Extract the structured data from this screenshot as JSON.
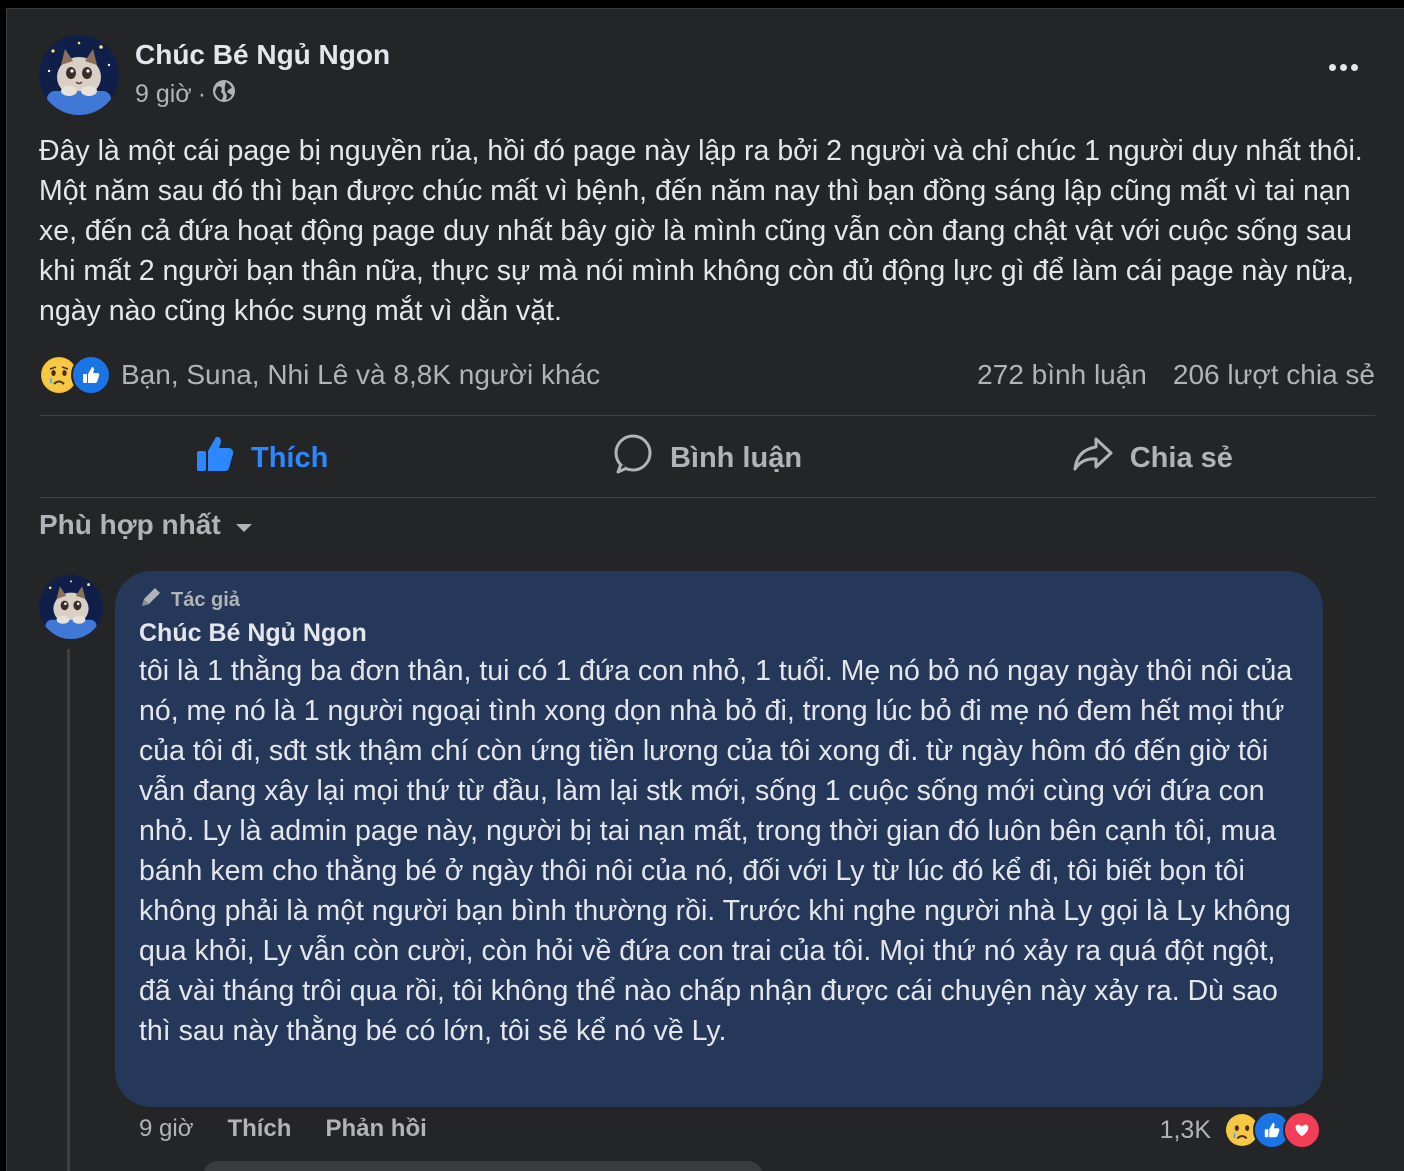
{
  "post": {
    "page_name": "Chúc Bé Ngủ Ngon",
    "time": "9 giờ",
    "separator": "·",
    "text": "Đây là một cái page bị nguyền rủa, hồi đó page này lập ra bởi 2 người và chỉ chúc 1 người duy nhất thôi. Một năm sau đó thì bạn được chúc mất vì bệnh, đến năm nay thì bạn đồng sáng lập cũng mất vì tai nạn xe, đến cả đứa hoạt động page duy nhất bây giờ là mình cũng vẫn còn đang chật vật với cuộc sống sau khi mất 2 người bạn thân nữa, thực sự mà nói mình không còn đủ động lực gì để làm cái page này nữa, ngày nào cũng khóc sưng mắt vì dằn vặt.",
    "reactors": "Bạn, Suna, Nhi Lê và 8,8K người khác",
    "comments_count": "272 bình luận",
    "shares_count": "206 lượt chia sẻ",
    "icons": {
      "privacy": "globe-icon",
      "more": "more-options-icon"
    }
  },
  "actions": {
    "like": "Thích",
    "comment": "Bình luận",
    "share": "Chia sẻ"
  },
  "sort": {
    "label": "Phù hợp nhất"
  },
  "comment": {
    "badge": "Tác giả",
    "author": "Chúc Bé Ngủ Ngon",
    "text": "tôi là 1 thằng ba đơn thân, tui có 1 đứa con nhỏ, 1 tuổi. Mẹ nó bỏ nó ngay ngày thôi nôi của nó, mẹ nó là 1 người ngoại tình xong dọn nhà bỏ đi, trong lúc bỏ đi mẹ nó đem hết mọi thứ của tôi đi, sđt stk thậm chí còn ứng tiền lương của tôi xong đi. từ ngày hôm đó đến giờ tôi vẫn đang xây lại mọi thứ từ đầu, làm lại stk mới, sống 1 cuộc sống mới cùng với đứa con nhỏ. Ly là admin page này, người bị tai nạn mất, trong thời gian đó luôn bên cạnh tôi, mua bánh kem cho thằng bé ở ngày thôi nôi của nó, đối với Ly từ lúc đó kể đi, tôi biết bọn tôi không phải là một người bạn bình thường rồi. Trước khi nghe người nhà Ly gọi là Ly không qua khỏi, Ly vẫn còn cười, còn hỏi về đứa con trai của tôi. Mọi thứ nó xảy ra quá đột ngột, đã vài tháng trôi qua rồi, tôi không thể nào chấp nhận được cái chuyện này xảy ra. Dù sao thì sau này thằng bé có lớn, tôi sẽ kể nó về Ly.",
    "time": "9 giờ",
    "like": "Thích",
    "reply": "Phản hồi",
    "reaction_count": "1,3K"
  },
  "colors": {
    "background": "#242526",
    "comment_bubble": "#263859",
    "like_blue": "#2d88ff",
    "secondary_text": "#b0b3b8",
    "love_red": "#f33e58",
    "sad_yellow": "#f7b928"
  }
}
